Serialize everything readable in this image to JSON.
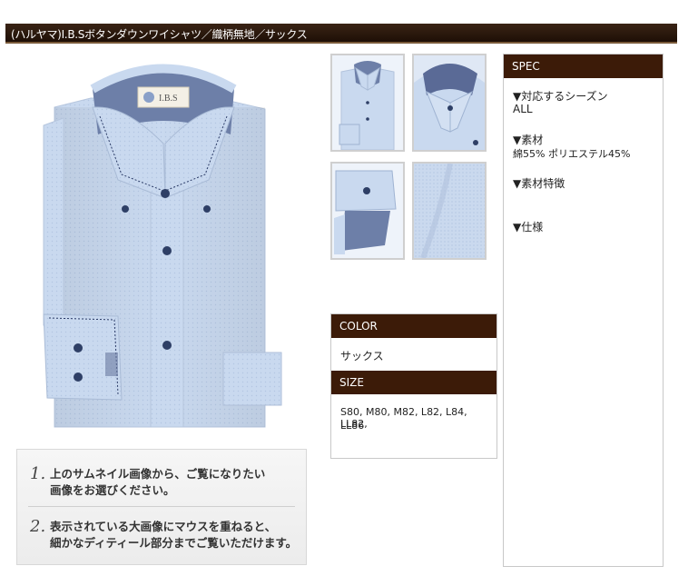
{
  "title": "(ハルヤマ)I.B.Sボタンダウンワイシャツ／織柄無地／サックス",
  "brand_tag": "I.B.S",
  "spec": {
    "heading": "SPEC",
    "season_label": "▼対応するシーズン",
    "season_value": "ALL",
    "material_label": "▼素材",
    "material_value": "綿55% ポリエステル45%",
    "feature_label": "▼素材特徴",
    "spec_label": "▼仕様"
  },
  "color": {
    "heading": "COLOR",
    "value": "サックス"
  },
  "size": {
    "heading": "SIZE",
    "line1": "S80, M80, M82, L82, L84, LL82,",
    "line2": "LL86"
  },
  "guide": {
    "step1_num": "1.",
    "step1_line1": "上のサムネイル画像から、ご覧になりたい",
    "step1_line2": "画像をお選びください。",
    "step2_num": "2.",
    "step2_line1": "表示されている大画像にマウスを重ねると、",
    "step2_line2": "細かなディティール部分までご覧いただけます。"
  },
  "colors": {
    "header_bg": "#3c1b08",
    "shirt": "#c9d9ef",
    "collar_lining": "#5a6a96"
  }
}
